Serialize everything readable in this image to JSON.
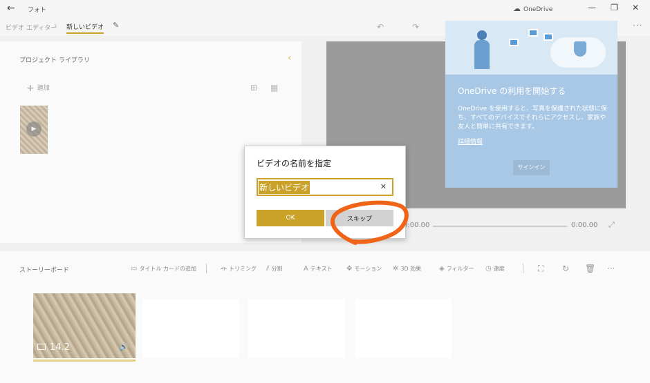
{
  "titlebar": {
    "app_title": "フォト",
    "onedrive_label": "OneDrive",
    "back_icon": "←",
    "minimize": "—",
    "restore": "❐",
    "close": "✕"
  },
  "breadcrumb": {
    "root": "ビデオ エディター",
    "separator": "›",
    "current": "新しいビデオ",
    "more": "···"
  },
  "library": {
    "title": "プロジェクト ライブラリ",
    "add_label": "追加",
    "collapse_glyph": "‹"
  },
  "preview": {
    "time_current": "0:00.00",
    "time_total": "0:00.00"
  },
  "onedrive_popup": {
    "title": "OneDrive の利用を開始する",
    "body": "OneDrive を使用すると、写真を保護された状態に保ち、すべてのデバイスでそれらにアクセスし、家族や友人と簡単に共有できます。",
    "link": "詳細情報",
    "signin": "サインイン"
  },
  "storyboard": {
    "title": "ストーリーボード",
    "tools": {
      "title_card": "タイトル カードの追加",
      "trim": "トリミング",
      "split": "分割",
      "text": "テキスト",
      "motion": "モーション",
      "effects_3d": "3D 効果",
      "filter": "フィルター",
      "speed": "速度"
    },
    "clip_duration": "14.2",
    "more": "···"
  },
  "dialog": {
    "title": "ビデオの名前を指定",
    "input_value": "新しいビデオ",
    "clear_icon": "✕",
    "ok": "OK",
    "skip": "スキップ"
  },
  "colors": {
    "accent": "#c9a227",
    "annotation": "#f06418",
    "onedrive_bg": "#a8c8e6"
  }
}
